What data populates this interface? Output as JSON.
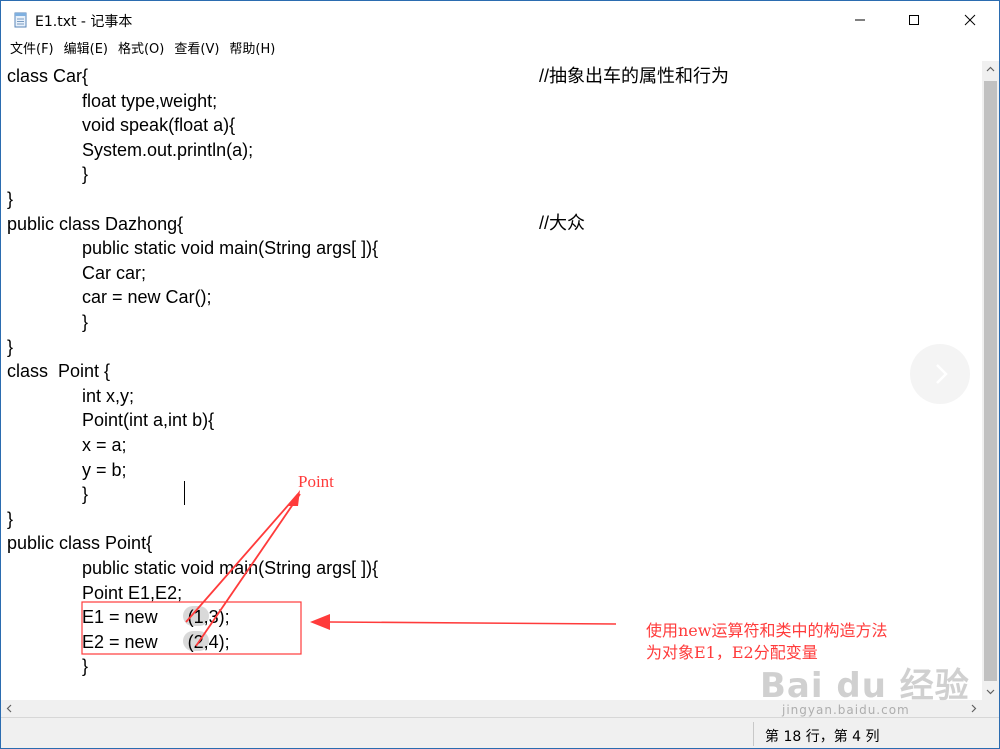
{
  "window": {
    "title": "E1.txt - 记事本",
    "icon": "notepad-icon",
    "controls": [
      "minimize-icon",
      "maximize-icon",
      "close-icon"
    ]
  },
  "menu": {
    "items": [
      "文件(F)",
      "编辑(E)",
      "格式(O)",
      "查看(V)",
      "帮助(H)"
    ]
  },
  "editor": {
    "lines": [
      "class Car{",
      "               float type,weight;",
      "               void speak(float a){",
      "               System.out.println(a);",
      "               }",
      "}",
      "public class Dazhong{",
      "               public static void main(String args[ ]){",
      "               Car car;",
      "               car = new Car();",
      "               }",
      "}",
      "class  Point {",
      "               int x,y;",
      "               Point(int a,int b){",
      "               x = a;",
      "               y = b;",
      "               }",
      "}",
      "public class Point{",
      "               public static void main(String args[ ]){",
      "               Point E1,E2;",
      "               E1 = new      (1,3);",
      "               E2 = new      (2,4);",
      "               }"
    ],
    "comments": [
      "//抽象出车的属性和行为",
      "//大众"
    ]
  },
  "status": {
    "position": "第 18 行，第 4 列"
  },
  "annotations": {
    "point_label": "Point",
    "note": "使用new运算符和类中的构造方法\n为对象E1，E2分配变量",
    "color": "#ff3b3b"
  },
  "watermark": {
    "brand": "Bai du 经验",
    "sub": "jingyan.baidu.com"
  }
}
